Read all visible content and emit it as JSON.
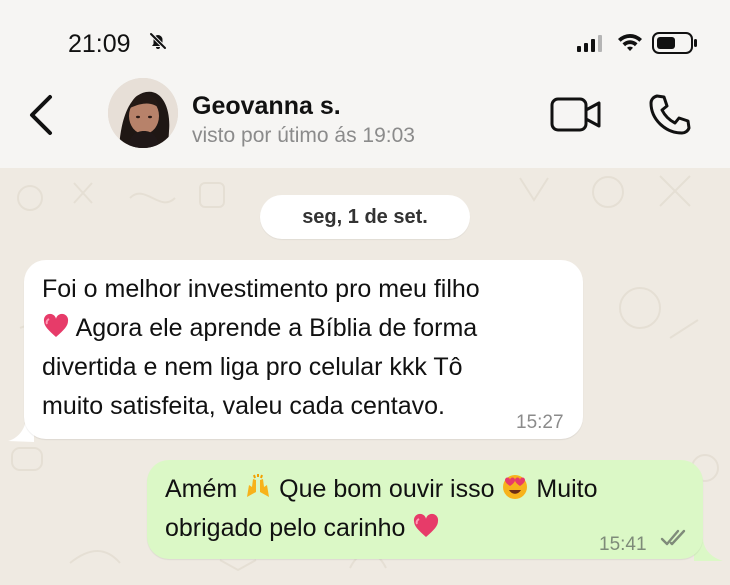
{
  "status_bar": {
    "time": "21:09"
  },
  "header": {
    "contact_name": "Geovanna s.",
    "last_seen": "visto por útimo ás 19:03"
  },
  "chat": {
    "date": "seg, 1 de set.",
    "incoming": {
      "line1": "Foi o melhor investimento pro meu filho",
      "line2": " Agora ele aprende a Bíblia de forma",
      "line3": "divertida e nem liga pro celular kkk Tô",
      "line4": "muito satisfeita, valeu cada centavo.",
      "time": "15:27"
    },
    "outgoing": {
      "part1": "Amém ",
      "part2": " Que bom ouvir isso ",
      "part3": " Muito",
      "part4": "obrigado pelo carinho ",
      "time": "15:41"
    }
  },
  "icons": {
    "back": "chevron-left-icon",
    "video": "video-call-icon",
    "phone": "phone-icon",
    "bell": "bell-off-icon"
  }
}
